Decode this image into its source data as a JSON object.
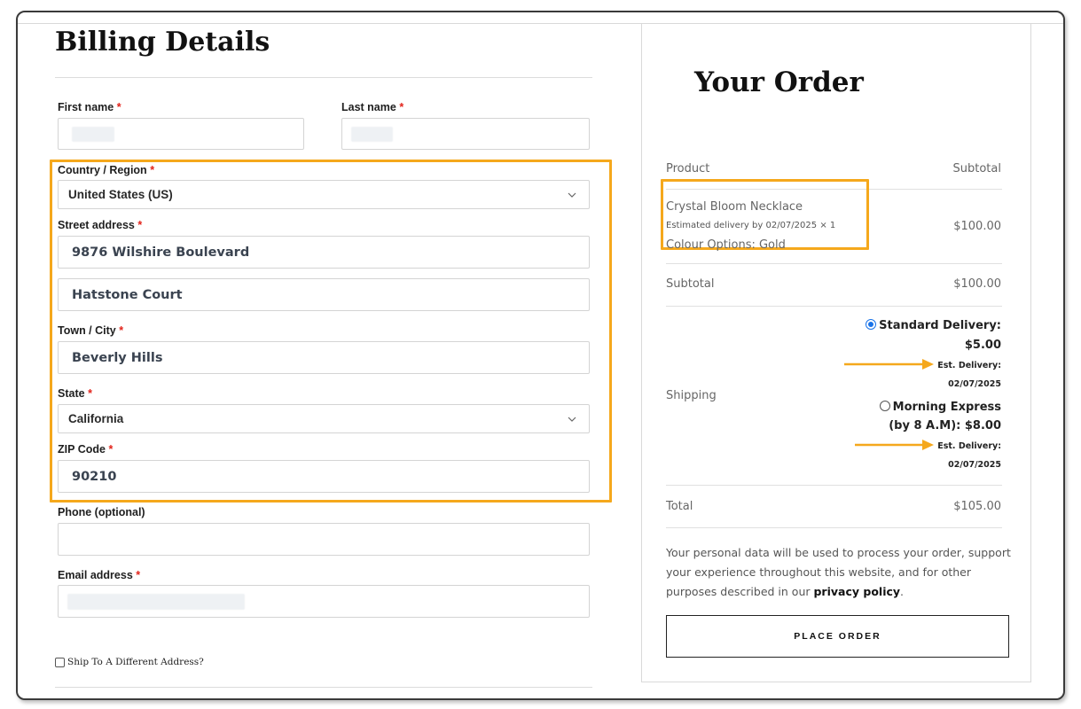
{
  "billing": {
    "title": "Billing Details",
    "first_name_label": "First name",
    "last_name_label": "Last name",
    "country_label": "Country / Region",
    "country_value": "United States (US)",
    "street_label": "Street address",
    "street_line1": "9876 Wilshire Boulevard",
    "street_line2": "Hatstone Court",
    "city_label": "Town / City",
    "city_value": "Beverly Hills",
    "state_label": "State",
    "state_value": "California",
    "zip_label": "ZIP Code",
    "zip_value": "90210",
    "phone_label": "Phone (optional)",
    "email_label": "Email address",
    "required_mark": "*",
    "ship_different_label": "Ship To A Different Address?"
  },
  "order": {
    "title": "Your Order",
    "col_product": "Product",
    "col_subtotal": "Subtotal",
    "item_name": "Crystal Bloom Necklace",
    "item_delivery": "Estimated delivery by 02/07/2025",
    "item_qty": "× 1",
    "item_option": "Colour Options: Gold",
    "item_price": "$100.00",
    "subtotal_label": "Subtotal",
    "subtotal_value": "$100.00",
    "shipping_label": "Shipping",
    "ship_standard_name": "Standard Delivery:",
    "ship_standard_price": "$5.00",
    "ship_standard_est_label": "Est. Delivery:",
    "ship_standard_est_date": "02/07/2025",
    "ship_express_name": "Morning Express",
    "ship_express_detail": "(by 8 A.M): $8.00",
    "ship_express_est_label": "Est. Delivery:",
    "ship_express_est_date": "02/07/2025",
    "total_label": "Total",
    "total_value": "$105.00",
    "privacy_text": "Your personal data will be used to process your order, support your experience throughout this website, and for other purposes described in our",
    "privacy_link": "privacy policy",
    "privacy_end": ".",
    "place_order_label": "PLACE ORDER"
  },
  "colors": {
    "highlight": "#f5a81c",
    "required": "#e2231a",
    "radio_selected": "#1a73e8"
  }
}
